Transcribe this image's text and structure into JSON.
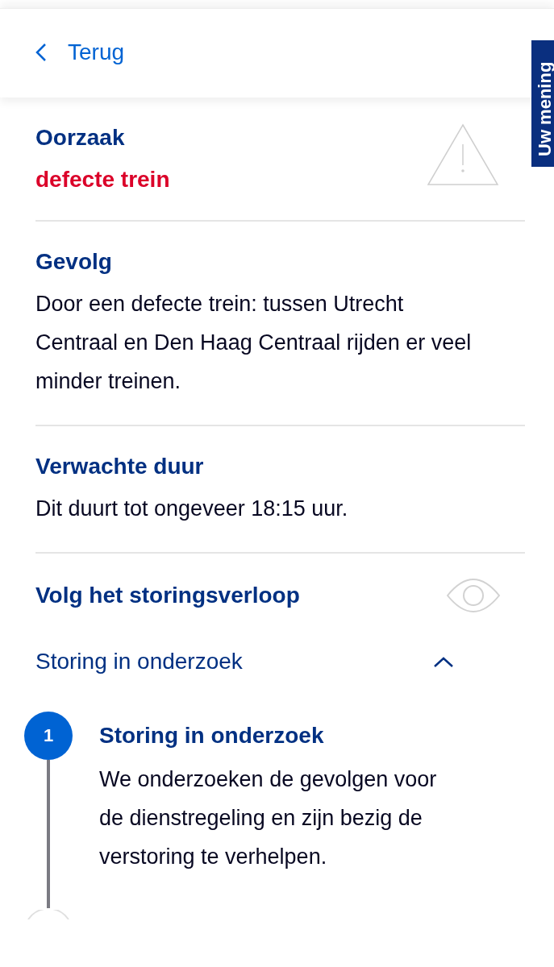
{
  "header": {
    "back_label": "Terug"
  },
  "feedback_tab": {
    "label": "Uw mening"
  },
  "sections": [
    {
      "kind": "cause",
      "title": "Oorzaak",
      "value": "defecte trein"
    },
    {
      "kind": "text",
      "title": "Gevolg",
      "text": "Door een defecte trein: tussen Utrecht Centraal en Den Haag Centraal rijden er veel minder treinen."
    },
    {
      "kind": "text",
      "title": "Verwachte duur",
      "text": "Dit duurt tot ongeveer 18:15 uur."
    },
    {
      "kind": "follow",
      "title": "Volg het storingsverloop"
    }
  ],
  "accordion": {
    "label": "Storing in onderzoek",
    "expanded": true,
    "steps": [
      {
        "number": "1",
        "title": "Storing in onderzoek",
        "text": "We onderzoeken de gevolgen voor de dienstregeling en zijn bezig de verstoring te verhelpen.",
        "active": true
      }
    ]
  }
}
